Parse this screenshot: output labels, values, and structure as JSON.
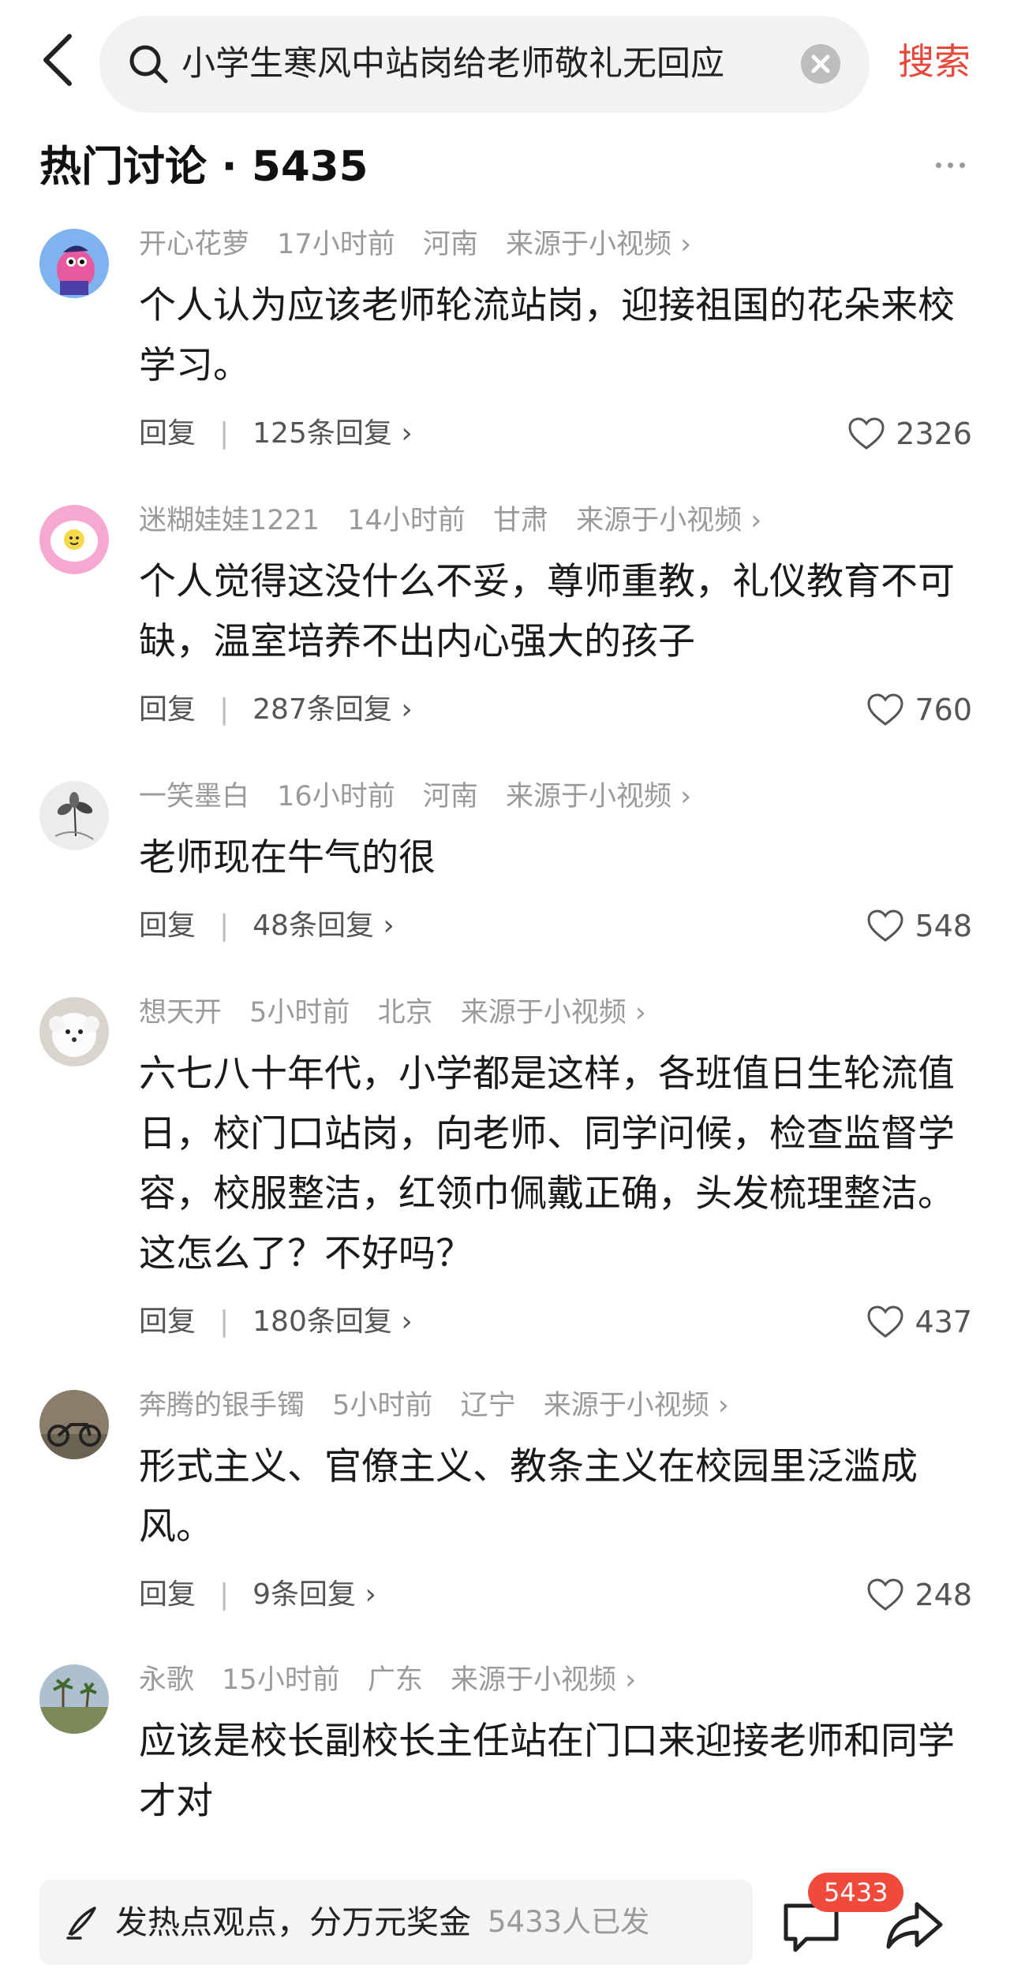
{
  "search": {
    "query": "小学生寒风中站岗给老师敬礼无回应",
    "button_label": "搜索"
  },
  "section": {
    "title": "热门讨论 · 5435"
  },
  "comments": [
    {
      "user": "开心花萝",
      "time": "17小时前",
      "location": "河南",
      "source": "来源于小视频 ›",
      "text": "个人认为应该老师轮流站岗，迎接祖国的花朵来校学习。",
      "reply_label": "回复",
      "reply_count": "125条回复 ›",
      "likes": "2326"
    },
    {
      "user": "迷糊娃娃1221",
      "time": "14小时前",
      "location": "甘肃",
      "source": "来源于小视频 ›",
      "text": "个人觉得这没什么不妥，尊师重教，礼仪教育不可缺，温室培养不出内心强大的孩子",
      "reply_label": "回复",
      "reply_count": "287条回复 ›",
      "likes": "760"
    },
    {
      "user": "一笑墨白",
      "time": "16小时前",
      "location": "河南",
      "source": "来源于小视频 ›",
      "text": "老师现在牛气的很",
      "reply_label": "回复",
      "reply_count": "48条回复 ›",
      "likes": "548"
    },
    {
      "user": "想天开",
      "time": "5小时前",
      "location": "北京",
      "source": "来源于小视频 ›",
      "text": "六七八十年代，小学都是这样，各班值日生轮流值日，校门口站岗，向老师、同学问候，检查监督学容，校服整洁，红领巾佩戴正确，头发梳理整洁。这怎么了？不好吗？",
      "reply_label": "回复",
      "reply_count": "180条回复 ›",
      "likes": "437"
    },
    {
      "user": "奔腾的银手镯",
      "time": "5小时前",
      "location": "辽宁",
      "source": "来源于小视频 ›",
      "text": "形式主义、官僚主义、教条主义在校园里泛滥成风。",
      "reply_label": "回复",
      "reply_count": "9条回复 ›",
      "likes": "248"
    },
    {
      "user": "永歌",
      "time": "15小时前",
      "location": "广东",
      "source": "来源于小视频 ›",
      "text": "应该是校长副校长主任站在门口来迎接老师和同学才对"
    }
  ],
  "bottom": {
    "compose_label": "发热点观点，分万元奖金",
    "compose_count": "5433人已发",
    "comment_badge": "5433"
  },
  "colors": {
    "accent": "#e8473b",
    "badge": "#f04a3c",
    "meta_text": "#9a9a9a"
  }
}
